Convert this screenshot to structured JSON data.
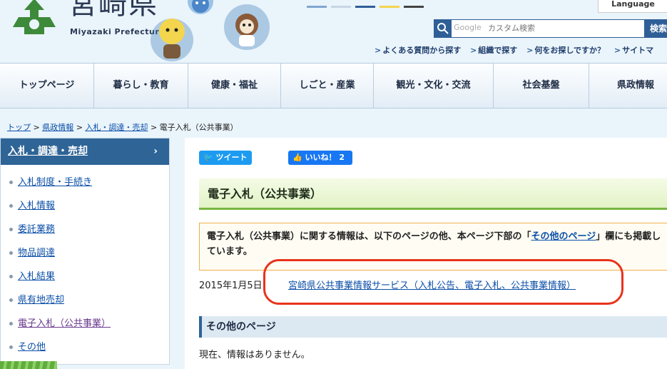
{
  "header": {
    "logo_kanji": "宮崎県",
    "logo_roman": "Miyazaki Prefecture",
    "language_label": "Language",
    "search_placeholder": "カスタム検索",
    "search_brand": "Google",
    "search_button": "検索",
    "util_links": [
      "よくある質問から探す",
      "組織で探す",
      "何をお探しですか？",
      "サイトマ"
    ]
  },
  "nav": {
    "items": [
      "トップページ",
      "暮らし・教育",
      "健康・福祉",
      "しごと・産業",
      "観光・文化・交流",
      "社会基盤",
      "県政情報"
    ]
  },
  "breadcrumb": {
    "items": [
      "トップ",
      "県政情報",
      "入札・調達・売却"
    ],
    "separator": ">",
    "current": "電子入札（公共事業）"
  },
  "sidebar": {
    "heading": "入札・調達・売却",
    "chevron": "›",
    "items": [
      "入札制度・手続き",
      "入札情報",
      "委託業務",
      "物品調達",
      "入札結果",
      "県有地売却",
      "電子入札（公共事業）",
      "その他"
    ]
  },
  "main": {
    "tweet_label": "ツイート",
    "like_label": "いいね！",
    "like_count": "2",
    "title": "電子入札（公共事業）",
    "notice_pre": "電子入札（公共事業）に関する情報は、以下のページの他、本ページ下部の「",
    "notice_link": "その他のページ",
    "notice_post": "」欄にも掲載しています。",
    "entry_date": "2015年1月5日",
    "entry_link": "宮崎県公共事業情報サービス（入札公告、電子入札、公共事業情報）",
    "other_heading": "その他のページ",
    "empty_message": "現在、情報はありません。"
  },
  "colors": {
    "nav_text": "#1e2c44",
    "sidebar_head": "#2e6496",
    "title_accent": "#76b642",
    "notice_border": "#f0b04a",
    "highlight": "#e8331c",
    "link": "#0b4fa8"
  }
}
